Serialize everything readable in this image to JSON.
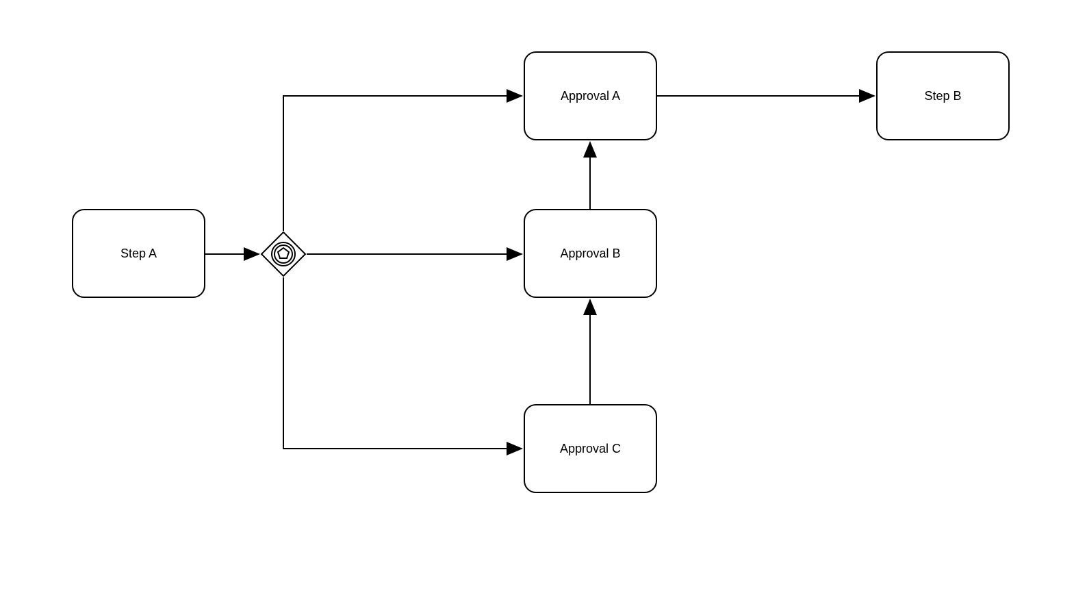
{
  "diagram": {
    "nodes": {
      "step_a": {
        "label": "Step A"
      },
      "approval_a": {
        "label": "Approval A"
      },
      "approval_b": {
        "label": "Approval B"
      },
      "approval_c": {
        "label": "Approval C"
      },
      "step_b": {
        "label": "Step B"
      }
    },
    "gateway": {
      "type": "complex"
    },
    "connections": [
      {
        "from": "step_a",
        "to": "gateway"
      },
      {
        "from": "gateway",
        "to": "approval_a"
      },
      {
        "from": "gateway",
        "to": "approval_b"
      },
      {
        "from": "gateway",
        "to": "approval_c"
      },
      {
        "from": "approval_c",
        "to": "approval_b"
      },
      {
        "from": "approval_b",
        "to": "approval_a"
      },
      {
        "from": "approval_a",
        "to": "step_b"
      }
    ]
  }
}
